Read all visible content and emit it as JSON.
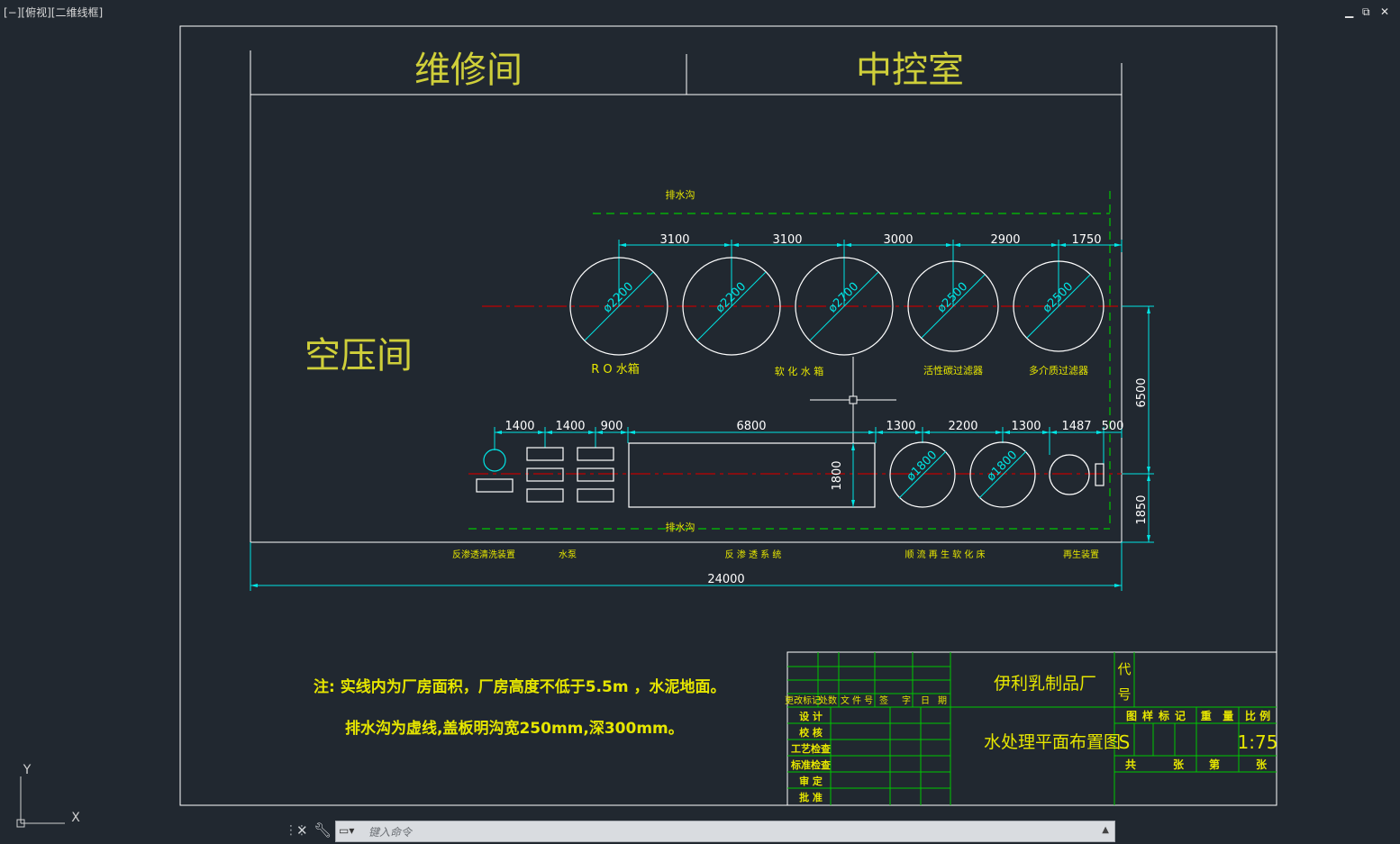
{
  "viewport": {
    "label": "[−][俯视][二维线框]"
  },
  "window_controls": {
    "minimize": "▁",
    "restore": "⧉",
    "close": "✕"
  },
  "rooms": {
    "repair": "维修间",
    "control": "中控室",
    "compressor": "空压间"
  },
  "drains": {
    "top": "排水沟",
    "bottom": "排水沟"
  },
  "top_dims": [
    "3100",
    "3100",
    "3000",
    "2900",
    "1750"
  ],
  "tank_diams": [
    "ø2200",
    "ø2200",
    "ø2700",
    "ø2500",
    "ø2500"
  ],
  "tank_labels": {
    "ro": "R O 水箱",
    "soft": "软 化 水 箱",
    "carbon": "活性碳过滤器",
    "multi": "多介质过滤器"
  },
  "bottom_dims": [
    "1400",
    "1400",
    "900",
    "6800",
    "1300",
    "2200",
    "1300",
    "1487",
    "500"
  ],
  "small_tank_diams": [
    "ø1800",
    "ø1800"
  ],
  "dim_1800": "1800",
  "right_dims": {
    "a": "6500",
    "b": "1850"
  },
  "total_dim": "24000",
  "equipment_labels": [
    "反渗透清洗装置",
    "水泵",
    "反 渗 透 系 统",
    "顺 流 再 生 软 化 床",
    "再生装置"
  ],
  "notes": {
    "line1": "注:  实线内为厂房面积，厂房高度不低于5.5m ，水泥地面。",
    "line2": "排水沟为虚线,盖板明沟宽250mm,深300mm。"
  },
  "title_block": {
    "company": "伊利乳制品厂",
    "drawing_title": "水处理平面布置图",
    "code_label_1": "代",
    "code_label_2": "号",
    "rev_headers": [
      "更改标记",
      "处数",
      "文 件 号",
      "签",
      "字",
      "日",
      "期"
    ],
    "sign_rows": [
      "设     计",
      "校     核",
      "工艺检查",
      "标准检查",
      "审     定",
      "批     准"
    ],
    "stage_headers": [
      "图",
      "样",
      "标",
      "记"
    ],
    "weight": "重   量",
    "scale_label": "比 例",
    "stage": "S",
    "scale": "1:75",
    "sheets_total": "共",
    "sheets_zhang1": "张",
    "sheets_no": "第",
    "sheets_zhang2": "张"
  },
  "ucs": {
    "y": "Y",
    "x": "X"
  },
  "command": {
    "placeholder": "键入命令",
    "prompt_icon": "▭▾"
  },
  "colors": {
    "background": "#212830",
    "line": "#ffffff",
    "dim": "#00e5e5",
    "label": "#e6e600",
    "room": "#cfcf3a",
    "green": "#00c800",
    "red": "#c00000"
  }
}
